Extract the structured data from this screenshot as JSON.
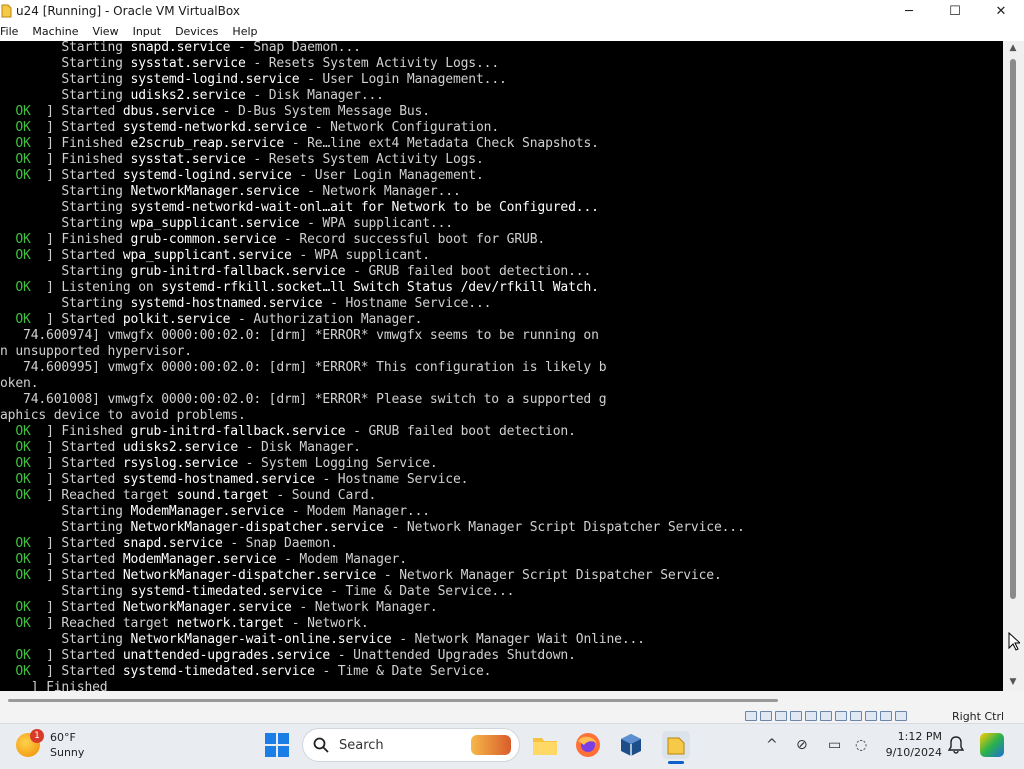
{
  "window": {
    "title": "u24 [Running] - Oracle VM VirtualBox",
    "controls": {
      "minimize": "─",
      "maximize": "☐",
      "close": "✕"
    }
  },
  "menubar": {
    "items": [
      "File",
      "Machine",
      "View",
      "Input",
      "Devices",
      "Help"
    ]
  },
  "terminal": {
    "lines": [
      {
        "prefix": "        ",
        "status": "",
        "mid": "Starting ",
        "unit": "snapd.service",
        "rest": " - Snap Daemon..."
      },
      {
        "prefix": "        ",
        "status": "",
        "mid": "Starting ",
        "unit": "sysstat.service",
        "rest": " - Resets System Activity Logs..."
      },
      {
        "prefix": "        ",
        "status": "",
        "mid": "Starting ",
        "unit": "systemd-logind.service",
        "rest": " - User Login Management..."
      },
      {
        "prefix": "        ",
        "status": "",
        "mid": "Starting ",
        "unit": "udisks2.service",
        "rest": " - Disk Manager..."
      },
      {
        "prefix": "  ",
        "status": "OK",
        "mid": "  ] Started ",
        "unit": "dbus.service",
        "rest": " - D-Bus System Message Bus."
      },
      {
        "prefix": "  ",
        "status": "OK",
        "mid": "  ] Started ",
        "unit": "systemd-networkd.service",
        "rest": " - Network Configuration."
      },
      {
        "prefix": "  ",
        "status": "OK",
        "mid": "  ] Finished ",
        "unit": "e2scrub_reap.service",
        "rest": " - Re…line ext4 Metadata Check Snapshots."
      },
      {
        "prefix": "  ",
        "status": "OK",
        "mid": "  ] Finished ",
        "unit": "sysstat.service",
        "rest": " - Resets System Activity Logs."
      },
      {
        "prefix": "  ",
        "status": "OK",
        "mid": "  ] Started ",
        "unit": "systemd-logind.service",
        "rest": " - User Login Management."
      },
      {
        "prefix": "        ",
        "status": "",
        "mid": "Starting ",
        "unit": "NetworkManager.service",
        "rest": " - Network Manager..."
      },
      {
        "prefix": "        ",
        "status": "",
        "mid": "Starting ",
        "unit": "systemd-networkd-wait-onl…ait for Network to be Configured...",
        "rest": ""
      },
      {
        "prefix": "        ",
        "status": "",
        "mid": "Starting ",
        "unit": "wpa_supplicant.service",
        "rest": " - WPA supplicant..."
      },
      {
        "prefix": "  ",
        "status": "OK",
        "mid": "  ] Finished ",
        "unit": "grub-common.service",
        "rest": " - Record successful boot for GRUB."
      },
      {
        "prefix": "  ",
        "status": "OK",
        "mid": "  ] Started ",
        "unit": "wpa_supplicant.service",
        "rest": " - WPA supplicant."
      },
      {
        "prefix": "        ",
        "status": "",
        "mid": "Starting ",
        "unit": "grub-initrd-fallback.service",
        "rest": " - GRUB failed boot detection..."
      },
      {
        "prefix": "  ",
        "status": "OK",
        "mid": "  ] Listening on ",
        "unit": "systemd-rfkill.socket…ll Switch Status /dev/rfkill Watch.",
        "rest": ""
      },
      {
        "prefix": "        ",
        "status": "",
        "mid": "Starting ",
        "unit": "systemd-hostnamed.service",
        "rest": " - Hostname Service..."
      },
      {
        "prefix": "  ",
        "status": "OK",
        "mid": "  ] Started ",
        "unit": "polkit.service",
        "rest": " - Authorization Manager."
      },
      {
        "prefix": "",
        "status": "",
        "mid": "   74.600974] vmwgfx 0000:00:02.0: [drm] *ERROR* vmwgfx seems to be running on",
        "unit": "",
        "rest": ""
      },
      {
        "prefix": "",
        "status": "",
        "mid": "n unsupported hypervisor.",
        "unit": "",
        "rest": ""
      },
      {
        "prefix": "",
        "status": "",
        "mid": "   74.600995] vmwgfx 0000:00:02.0: [drm] *ERROR* This configuration is likely b",
        "unit": "",
        "rest": ""
      },
      {
        "prefix": "",
        "status": "",
        "mid": "oken.",
        "unit": "",
        "rest": ""
      },
      {
        "prefix": "",
        "status": "",
        "mid": "   74.601008] vmwgfx 0000:00:02.0: [drm] *ERROR* Please switch to a supported g",
        "unit": "",
        "rest": ""
      },
      {
        "prefix": "",
        "status": "",
        "mid": "aphics device to avoid problems.",
        "unit": "",
        "rest": ""
      },
      {
        "prefix": "  ",
        "status": "OK",
        "mid": "  ] Finished ",
        "unit": "grub-initrd-fallback.service",
        "rest": " - GRUB failed boot detection."
      },
      {
        "prefix": "  ",
        "status": "OK",
        "mid": "  ] Started ",
        "unit": "udisks2.service",
        "rest": " - Disk Manager."
      },
      {
        "prefix": "  ",
        "status": "OK",
        "mid": "  ] Started ",
        "unit": "rsyslog.service",
        "rest": " - System Logging Service."
      },
      {
        "prefix": "  ",
        "status": "OK",
        "mid": "  ] Started ",
        "unit": "systemd-hostnamed.service",
        "rest": " - Hostname Service."
      },
      {
        "prefix": "  ",
        "status": "OK",
        "mid": "  ] Reached target ",
        "unit": "sound.target",
        "rest": " - Sound Card."
      },
      {
        "prefix": "        ",
        "status": "",
        "mid": "Starting ",
        "unit": "ModemManager.service",
        "rest": " - Modem Manager..."
      },
      {
        "prefix": "        ",
        "status": "",
        "mid": "Starting ",
        "unit": "NetworkManager-dispatcher.service",
        "rest": " - Network Manager Script Dispatcher Service..."
      },
      {
        "prefix": "  ",
        "status": "OK",
        "mid": "  ] Started ",
        "unit": "snapd.service",
        "rest": " - Snap Daemon."
      },
      {
        "prefix": "  ",
        "status": "OK",
        "mid": "  ] Started ",
        "unit": "ModemManager.service",
        "rest": " - Modem Manager."
      },
      {
        "prefix": "  ",
        "status": "OK",
        "mid": "  ] Started ",
        "unit": "NetworkManager-dispatcher.service",
        "rest": " - Network Manager Script Dispatcher Service."
      },
      {
        "prefix": "        ",
        "status": "",
        "mid": "Starting ",
        "unit": "systemd-timedated.service",
        "rest": " - Time & Date Service..."
      },
      {
        "prefix": "  ",
        "status": "OK",
        "mid": "  ] Started ",
        "unit": "NetworkManager.service",
        "rest": " - Network Manager."
      },
      {
        "prefix": "  ",
        "status": "OK",
        "mid": "  ] Reached target ",
        "unit": "network.target",
        "rest": " - Network."
      },
      {
        "prefix": "        ",
        "status": "",
        "mid": "Starting ",
        "unit": "NetworkManager-wait-online.service",
        "rest": " - Network Manager Wait Online..."
      },
      {
        "prefix": "  ",
        "status": "OK",
        "mid": "  ] Started ",
        "unit": "unattended-upgrades.service",
        "rest": " - Unattended Upgrades Shutdown."
      },
      {
        "prefix": "  ",
        "status": "OK",
        "mid": "  ] Started ",
        "unit": "systemd-timedated.service",
        "rest": " - Time & Date Service."
      },
      {
        "prefix": "  ",
        "status": "",
        "mid": "  ] Finished",
        "unit": "",
        "rest": ""
      }
    ]
  },
  "statusbar": {
    "host_key": "Right Ctrl"
  },
  "taskbar": {
    "weather": {
      "temp": "60°F",
      "condition": "Sunny",
      "alerts": "1"
    },
    "search_label": "Search",
    "clock": {
      "time": "1:12 PM",
      "date": "9/10/2024"
    },
    "tray": {
      "chevron": "^",
      "network": "⊘",
      "display": "▭",
      "sound": "◌"
    },
    "apps": [
      "file-explorer",
      "firefox",
      "virtualbox",
      "virtualbox-vm"
    ]
  },
  "colors": {
    "ok": "#3fbf3f",
    "terminal_bg": "#000000",
    "accent": "#0a62c9"
  }
}
